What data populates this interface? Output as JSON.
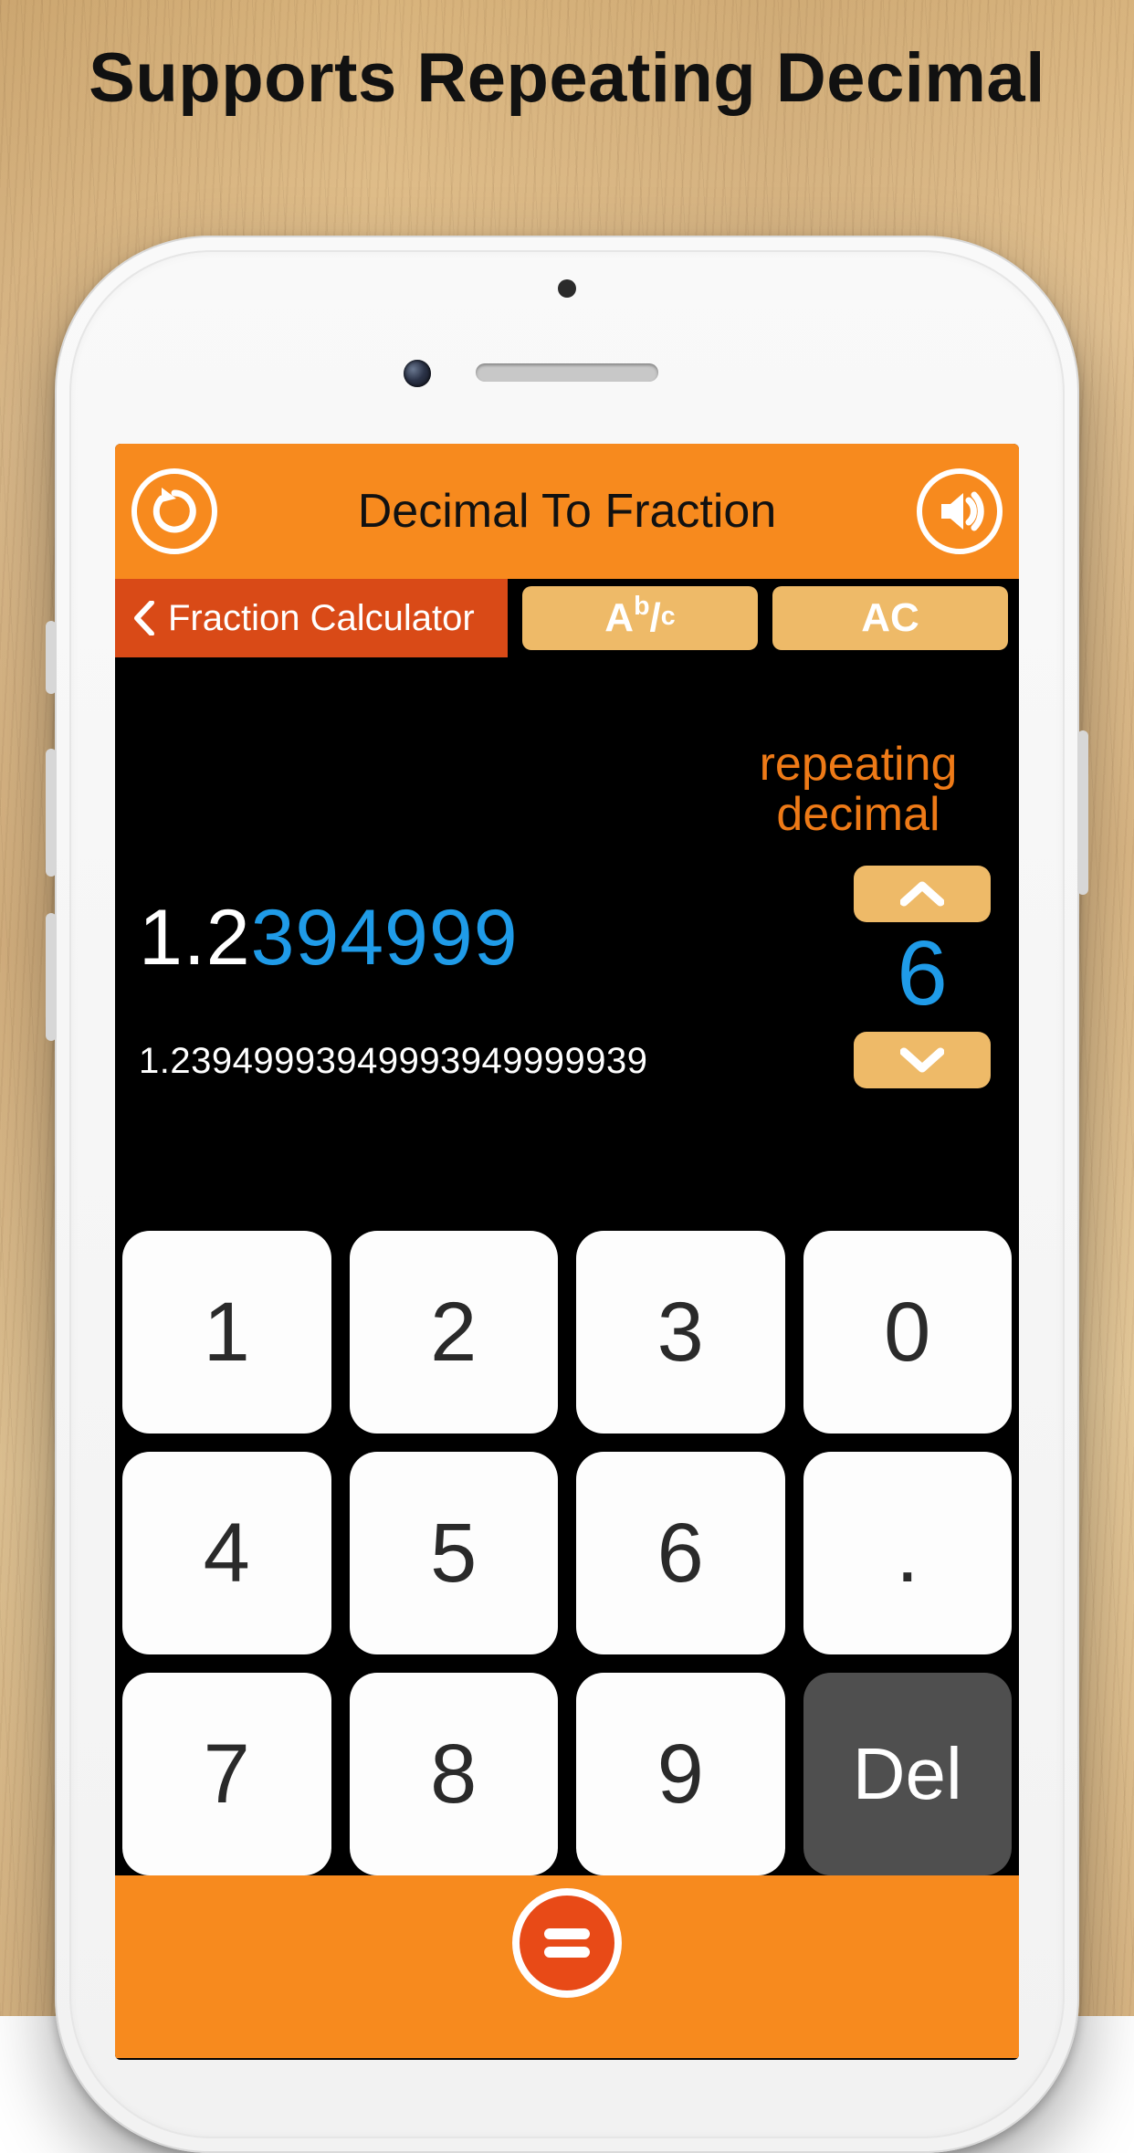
{
  "promo": {
    "headline": "Supports Repeating Decimal"
  },
  "colors": {
    "accent_orange": "#f78a1e",
    "accent_dark_orange": "#d94a17",
    "pill": "#eeba68",
    "highlight_blue": "#1f9be8"
  },
  "header": {
    "title": "Decimal To Fraction",
    "refresh_icon": "refresh-icon",
    "sound_icon": "speaker-icon"
  },
  "toolbar": {
    "back_label": "Fraction Calculator",
    "mixed_fraction_label_a": "A",
    "mixed_fraction_label_b": "b",
    "mixed_fraction_label_c": "c",
    "all_clear_label": "AC"
  },
  "display": {
    "repeating_label": "repeating decimal",
    "input_prefix": "1.2",
    "input_highlight": "394999",
    "expanded": "1.23949993949993949999939",
    "repeat_count": "6"
  },
  "keypad": {
    "rows": [
      [
        "1",
        "2",
        "3",
        "0"
      ],
      [
        "4",
        "5",
        "6",
        "."
      ],
      [
        "7",
        "8",
        "9",
        "Del"
      ]
    ]
  },
  "footer": {
    "equals_icon": "equals-icon"
  }
}
